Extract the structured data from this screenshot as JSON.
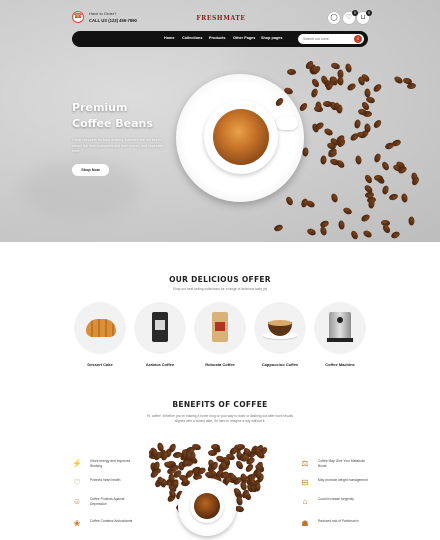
{
  "header": {
    "order_question": "Have to Order?",
    "order_phone": "CALL US (123) 456-7890",
    "logo": "FRESHMATE"
  },
  "icons": {
    "user": "user-icon",
    "wishlist": "heart-icon",
    "cart": "cart-icon",
    "wishlist_count": "0",
    "cart_count": "0"
  },
  "nav": {
    "items": [
      "Home",
      "Collections",
      "Products",
      "Other Pages",
      "Shop pages"
    ],
    "search_placeholder": "Search our store"
  },
  "hero": {
    "title_line1": "Premium",
    "title_line2": "Coffee Beans",
    "description": "Great shoppers for food delivery, bakeries are the key to attract the new customers and earn money and especially food.",
    "button": "Shop Now"
  },
  "offer": {
    "title": "OUR DELICIOUS OFFER",
    "subtitle": "Shop our best selling collections for a range of delicious tasty joy",
    "items": [
      "Dessert Cake",
      "Arabica Coffee",
      "Robusta Coffee",
      "Cappuccino Coffee",
      "Coffee Machine"
    ]
  },
  "benefits": {
    "title": "BENEFITS OF COFFEE",
    "subtitle": "Hi, coffee. Whether you're making a home mug or your way to work or dashing out after work results aligned with a skinny latte, it's hard to imagine a day without it.",
    "left": [
      "Gives energy and Improves Working",
      "Protects heart health",
      "Coffee Protects Against Depression",
      "Coffee Contains Antioxidants"
    ],
    "right": [
      "Coffee May Give Your Metabolic Boost",
      "May promote weight management",
      "Could increase longevity",
      "Reduced risk of Parkinson's"
    ]
  },
  "colors": {
    "accent": "#c43c2c",
    "brand": "#8a1c1c",
    "nav_bg": "#111111",
    "icon_accent": "#c07424"
  }
}
